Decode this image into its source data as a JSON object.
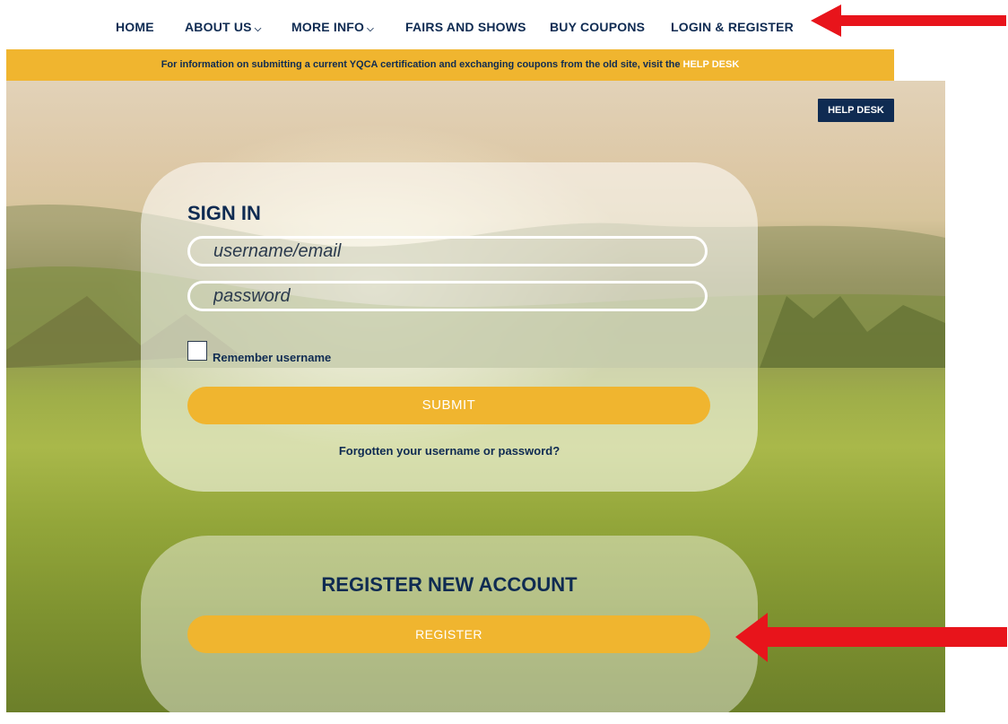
{
  "nav": {
    "items": [
      {
        "label": "HOME",
        "dropdown": false
      },
      {
        "label": "ABOUT US",
        "dropdown": true
      },
      {
        "label": "MORE INFO",
        "dropdown": true
      },
      {
        "label": "FAIRS AND SHOWS",
        "dropdown": false
      },
      {
        "label": "BUY COUPONS",
        "dropdown": false
      },
      {
        "label": "LOGIN & REGISTER",
        "dropdown": false
      }
    ],
    "chevron": "⌵"
  },
  "banner": {
    "text": "For information on submitting a current YQCA certification and exchanging coupons from the old site, visit the ",
    "link": "HELP DESK"
  },
  "help_desk_button": "HELP DESK",
  "signin": {
    "title": "SIGN IN",
    "username_placeholder": "username/email",
    "password_placeholder": "password",
    "remember_label": "Remember username",
    "submit_label": "SUBMIT",
    "forgot_link": "Forgotten your username or password?"
  },
  "register": {
    "title": "REGISTER NEW ACCOUNT",
    "button_label": "REGISTER"
  },
  "colors": {
    "navy": "#0f2b52",
    "gold": "#f0b52f",
    "arrow_red": "#e8141b"
  },
  "icons": [
    "chevron-down-icon",
    "red-arrow-icon"
  ]
}
